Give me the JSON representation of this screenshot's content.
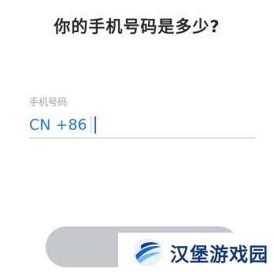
{
  "page": {
    "title": "你的手机号码是多少?"
  },
  "phone_field": {
    "label": "手机号码",
    "country_code": "CN +86",
    "value": ""
  },
  "continue_button": {
    "label": ""
  },
  "watermark": {
    "text": "汉堡游戏园",
    "logo_icon": "swoosh-globe-logo"
  },
  "colors": {
    "accent": "#2779d6",
    "title_text": "#2b2b2b",
    "label_text": "#9aa0a6",
    "button_disabled": "#c5c8cd",
    "watermark_text": "#123a78"
  }
}
